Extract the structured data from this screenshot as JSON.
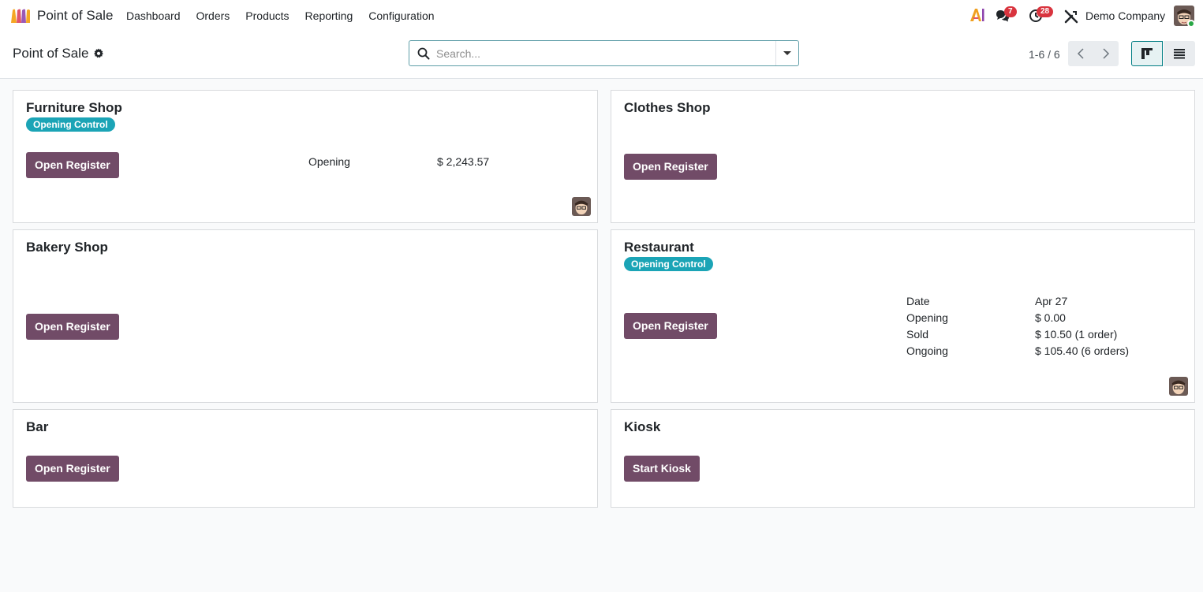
{
  "navbar": {
    "app_name": "Point of Sale",
    "menu": [
      "Dashboard",
      "Orders",
      "Products",
      "Reporting",
      "Configuration"
    ],
    "messages_count": "7",
    "activities_count": "28",
    "company": "Demo Company"
  },
  "control_panel": {
    "breadcrumb": "Point of Sale",
    "search_placeholder": "Search...",
    "pager": "1-6 / 6"
  },
  "cards": [
    {
      "title": "Furniture Shop",
      "tag": "Opening Control",
      "button": "Open Register",
      "stats": [
        {
          "label": "Opening",
          "value": "$ 2,243.57"
        }
      ]
    },
    {
      "title": "Clothes Shop",
      "button": "Open Register"
    },
    {
      "title": "Bakery Shop",
      "button": "Open Register"
    },
    {
      "title": "Restaurant",
      "tag": "Opening Control",
      "button": "Open Register",
      "stats": [
        {
          "label": "Date",
          "value": "Apr 27"
        },
        {
          "label": "Opening",
          "value": "$ 0.00"
        },
        {
          "label": "Sold",
          "value": "$ 10.50 (1 order)"
        },
        {
          "label": "Ongoing",
          "value": "$ 105.40 (6 orders)"
        }
      ]
    },
    {
      "title": "Bar",
      "button": "Open Register"
    },
    {
      "title": "Kiosk",
      "button": "Start Kiosk"
    }
  ],
  "colors": {
    "primary": "#714b67",
    "tag": "#1ba4b6",
    "badge": "#d9343e",
    "online": "#28a745"
  }
}
